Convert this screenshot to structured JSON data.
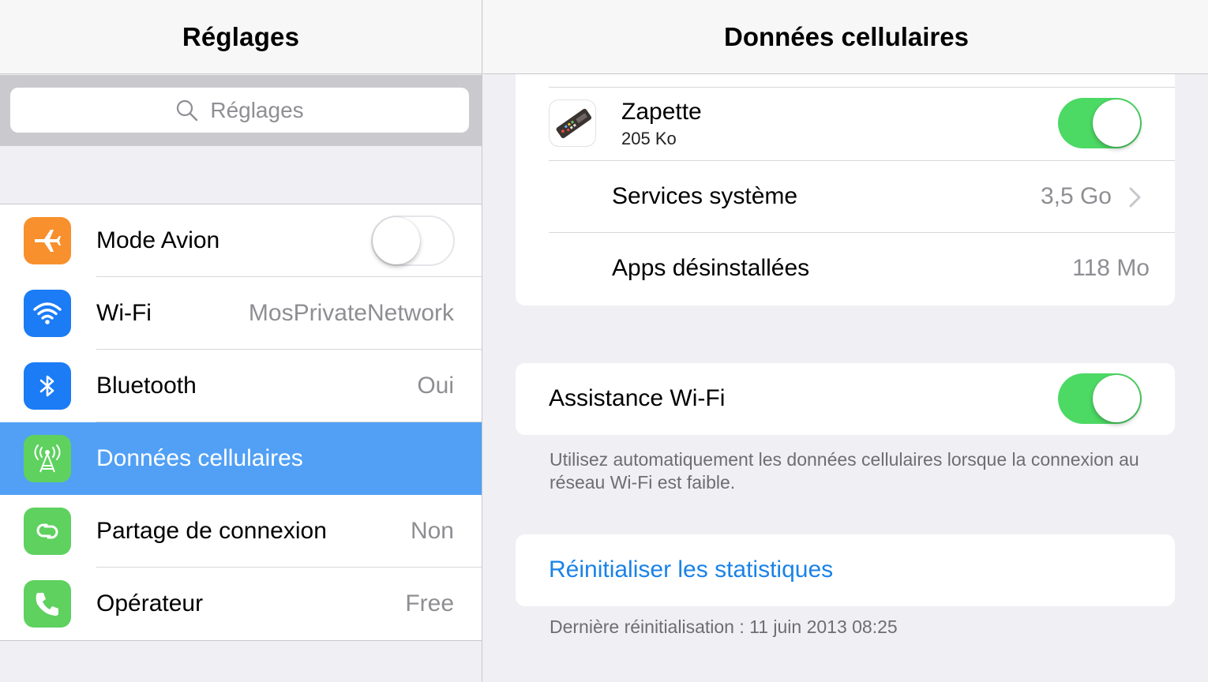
{
  "left": {
    "title": "Réglages",
    "search_placeholder": "Réglages",
    "items": [
      {
        "label": "Mode Avion",
        "value": "",
        "icon": "airplane-icon",
        "color": "#f7902d",
        "toggle": "off"
      },
      {
        "label": "Wi-Fi",
        "value": "MosPrivateNetwork",
        "icon": "wifi-icon",
        "color": "#1b7cf5"
      },
      {
        "label": "Bluetooth",
        "value": "Oui",
        "icon": "bluetooth-icon",
        "color": "#1b7cf5"
      },
      {
        "label": "Données cellulaires",
        "value": "",
        "icon": "cellular-antenna-icon",
        "color": "#5ed15f",
        "selected": true
      },
      {
        "label": "Partage de connexion",
        "value": "Non",
        "icon": "hotspot-icon",
        "color": "#5ed15f"
      },
      {
        "label": "Opérateur",
        "value": "Free",
        "icon": "phone-icon",
        "color": "#5ed15f"
      }
    ]
  },
  "right": {
    "title": "Données cellulaires",
    "app": {
      "name": "Zapette",
      "size": "205 Ko",
      "toggle": "on",
      "icon": "remote-control-icon"
    },
    "system_services": {
      "label": "Services système",
      "value": "3,5 Go"
    },
    "uninstalled": {
      "label": "Apps désinstallées",
      "value": "118 Mo"
    },
    "wifi_assist": {
      "label": "Assistance Wi-Fi",
      "toggle": "on"
    },
    "wifi_assist_note": "Utilisez automatiquement les données cellulaires lorsque la connexion au réseau Wi-Fi est faible.",
    "reset_label": "Réinitialiser les statistiques",
    "last_reset": "Dernière réinitialisation : 11 juin 2013 08:25"
  },
  "colors": {
    "accent": "#1a82e8",
    "selected_row": "#51a0f5",
    "toggle_on": "#4cd964"
  }
}
